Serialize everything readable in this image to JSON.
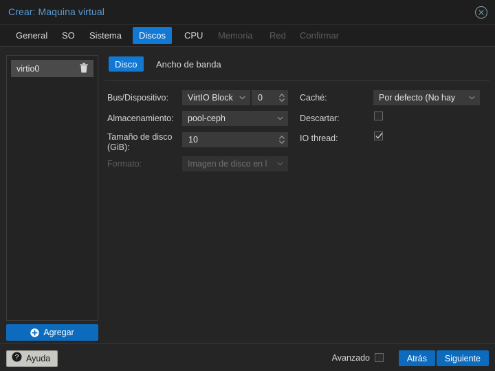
{
  "window": {
    "title": "Crear: Maquina virtual",
    "close_icon": "close-circle-icon",
    "accent_blue": "#1178d4",
    "title_color": "#5b9bd5"
  },
  "wizard_tabs": [
    {
      "label": "General",
      "state": "enabled"
    },
    {
      "label": "SO",
      "state": "enabled"
    },
    {
      "label": "Sistema",
      "state": "enabled"
    },
    {
      "label": "Discos",
      "state": "active"
    },
    {
      "label": "CPU",
      "state": "enabled"
    },
    {
      "label": "Memoria",
      "state": "disabled"
    },
    {
      "label": "Red",
      "state": "disabled"
    },
    {
      "label": "Confirmar",
      "state": "disabled"
    }
  ],
  "disk_list": {
    "items": [
      {
        "label": "virtio0",
        "selected": true,
        "delete_icon": "trash-icon"
      }
    ],
    "add_button": {
      "label": "Agregar",
      "icon": "plus-circle-icon"
    }
  },
  "inner_tabs": [
    {
      "label": "Disco",
      "state": "active"
    },
    {
      "label": "Ancho de banda",
      "state": "enabled"
    }
  ],
  "form": {
    "bus_device": {
      "label": "Bus/Dispositivo:",
      "select_value": "VirtIO Block",
      "spinner_value": "0"
    },
    "storage": {
      "label": "Almacenamiento:",
      "select_value": "pool-ceph"
    },
    "disk_size": {
      "label_line1": "Tamaño de disco",
      "label_line2": "(GiB):",
      "value": "10"
    },
    "format": {
      "label": "Formato:",
      "select_value": "Imagen de disco en l",
      "disabled": true
    },
    "cache": {
      "label": "Caché:",
      "select_value": "Por defecto (No hay"
    },
    "discard": {
      "label": "Descartar:",
      "checked": false
    },
    "io_thread": {
      "label": "IO thread:",
      "checked": true
    }
  },
  "footer": {
    "help_label": "Ayuda",
    "help_icon": "question-mark-icon",
    "advanced_label": "Avanzado",
    "advanced_checked": false,
    "back_label": "Atrás",
    "next_label": "Siguiente"
  }
}
